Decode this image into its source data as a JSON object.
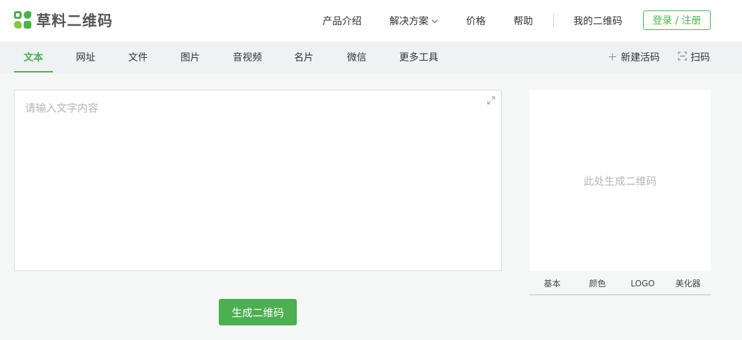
{
  "header": {
    "logo_text": "草料二维码",
    "nav": [
      {
        "label": "产品介绍"
      },
      {
        "label": "解决方案"
      },
      {
        "label": "价格"
      },
      {
        "label": "帮助"
      },
      {
        "label": "我的二维码"
      }
    ],
    "login_label": "登录 / 注册"
  },
  "tabs": [
    {
      "label": "文本",
      "active": true
    },
    {
      "label": "网址"
    },
    {
      "label": "文件"
    },
    {
      "label": "图片"
    },
    {
      "label": "音视频"
    },
    {
      "label": "名片"
    },
    {
      "label": "微信"
    },
    {
      "label": "更多工具"
    }
  ],
  "tools": {
    "new_code_label": "新建活码",
    "new_code_icon": "plus-icon",
    "scan_label": "扫码",
    "scan_icon": "scan-icon"
  },
  "editor": {
    "placeholder": "请输入文字内容",
    "value": "",
    "expand_icon": "expand-icon"
  },
  "generate_label": "生成二维码",
  "preview": {
    "hint": "此处生成二维码",
    "option_tabs": [
      "基本",
      "颜色",
      "LOGO",
      "美化器"
    ]
  },
  "colors": {
    "accent": "#4caf50",
    "accent_light": "#8bc34a",
    "bg": "#f5f7f7",
    "tabbar_bg": "#eef2f2"
  }
}
